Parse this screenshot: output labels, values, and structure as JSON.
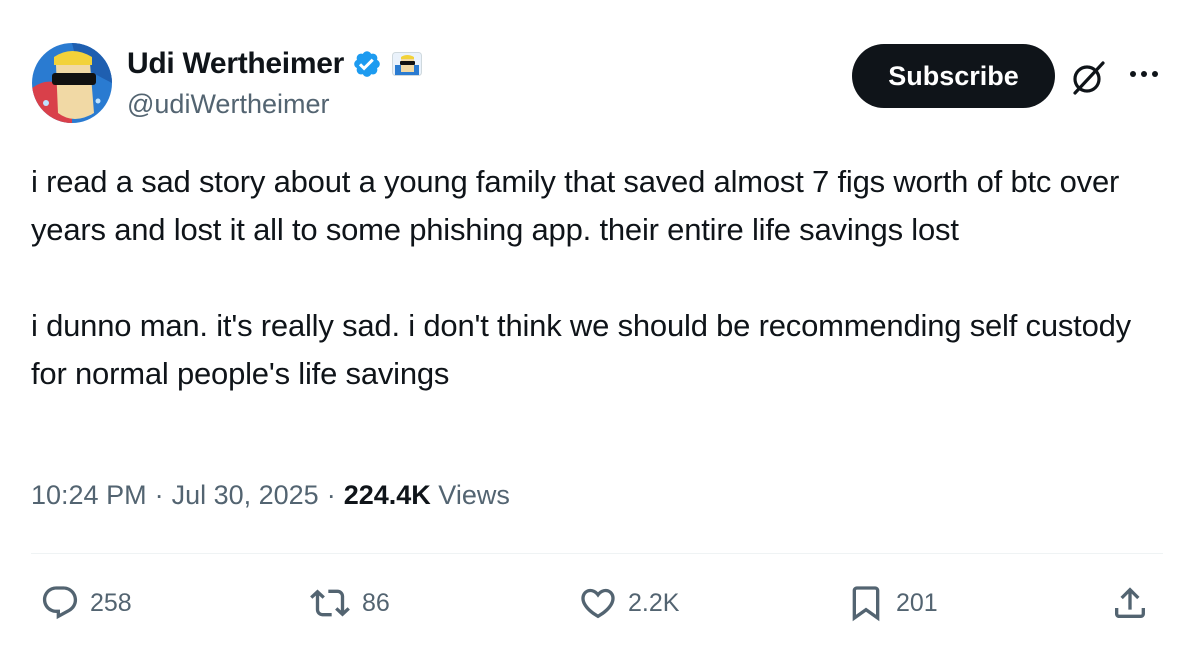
{
  "author": {
    "display_name": "Udi Wertheimer",
    "handle": "@udiWertheimer",
    "verified_icon": "verified-badge-icon",
    "affiliate_icon": "sunglasses-avatar-badge"
  },
  "header": {
    "subscribe_label": "Subscribe",
    "grok_icon": "grok-icon",
    "more_icon": "more-options-icon"
  },
  "tweet": {
    "paragraphs": [
      "i read a sad story about a young family that saved almost 7 figs worth of btc over years and lost it all to some phishing app. their entire life savings lost",
      "i dunno man. it's really sad. i don't think we should be recommending self custody for normal people's life savings"
    ],
    "time": "10:24 PM",
    "date": "Jul 30, 2025",
    "separator": "·",
    "views_count": "224.4K",
    "views_label": "Views"
  },
  "actions": {
    "replies": "258",
    "reposts": "86",
    "likes": "2.2K",
    "bookmarks": "201"
  },
  "colors": {
    "text": "#0f1419",
    "secondary": "#536471",
    "verified": "#1d9bf0",
    "button_bg": "#0f1419"
  }
}
